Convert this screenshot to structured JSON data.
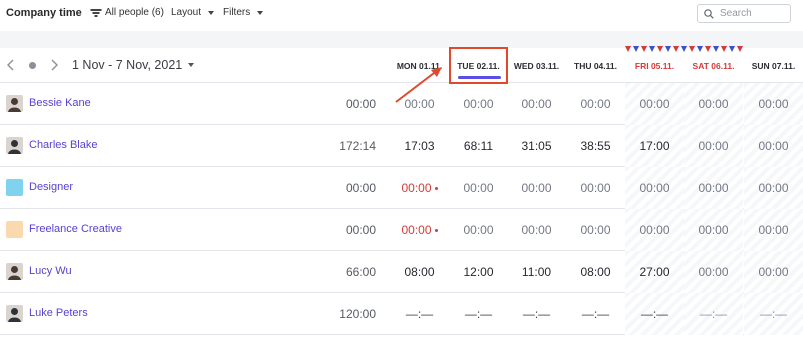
{
  "toolbar": {
    "title": "Company time",
    "people_filter": "All people (6)",
    "layout": "Layout",
    "filters": "Filters",
    "search_placeholder": "Search"
  },
  "header": {
    "date_range": "1 Nov - 7 Nov, 2021",
    "days": [
      {
        "label": "MON 01.11.",
        "holiday": false
      },
      {
        "label": "TUE 02.11.",
        "holiday": false,
        "selected": true
      },
      {
        "label": "WED 03.11.",
        "holiday": false
      },
      {
        "label": "THU 04.11.",
        "holiday": false
      },
      {
        "label": "FRI 05.11.",
        "holiday": true
      },
      {
        "label": "SAT 06.11.",
        "holiday": true
      },
      {
        "label": "SUN 07.11.",
        "holiday": false
      }
    ]
  },
  "rows": [
    {
      "name": "Bessie Kane",
      "total": "00:00",
      "cells": [
        "00:00",
        "00:00",
        "00:00",
        "00:00",
        "00:00",
        "00:00",
        "00:00"
      ],
      "avatar": "photo"
    },
    {
      "name": "Charles Blake",
      "total": "172:14",
      "cells": [
        "17:03",
        "68:11",
        "31:05",
        "38:55",
        "17:00",
        "00:00",
        "00:00"
      ],
      "avatar": "photo"
    },
    {
      "name": "Designer",
      "total": "00:00",
      "cells": [
        "00:00",
        "00:00",
        "00:00",
        "00:00",
        "00:00",
        "00:00",
        "00:00"
      ],
      "avatar": "color",
      "avatar_color": "#7fd3ee"
    },
    {
      "name": "Freelance Creative",
      "total": "00:00",
      "cells": [
        "00:00",
        "00:00",
        "00:00",
        "00:00",
        "00:00",
        "00:00",
        "00:00"
      ],
      "avatar": "color",
      "avatar_color": "#fbd9ae"
    },
    {
      "name": "Lucy Wu",
      "total": "66:00",
      "cells": [
        "08:00",
        "12:00",
        "11:00",
        "08:00",
        "27:00",
        "00:00",
        "00:00"
      ],
      "avatar": "photo"
    },
    {
      "name": "Luke Peters",
      "total": "120:00",
      "cells": [
        "—:—",
        "—:—",
        "—:—",
        "—:—",
        "—:—",
        "—:—",
        "—:—"
      ],
      "avatar": "photo"
    }
  ],
  "colors": {
    "accent": "#5b4ee8",
    "name_link": "#5b3fd0",
    "holiday": "#d43b3b",
    "annotation": "#e0492d"
  }
}
